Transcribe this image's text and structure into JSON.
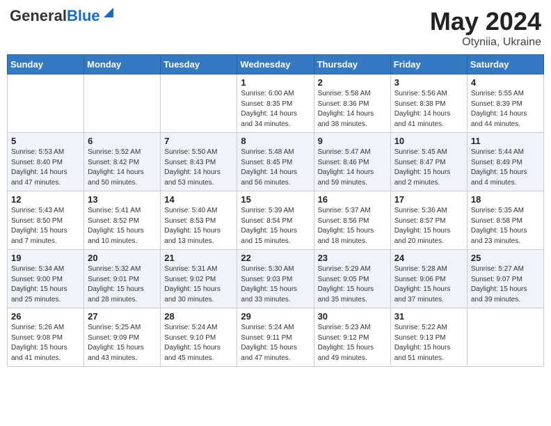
{
  "header": {
    "logo_general": "General",
    "logo_blue": "Blue",
    "title": "May 2024",
    "location": "Otyniia, Ukraine"
  },
  "days_of_week": [
    "Sunday",
    "Monday",
    "Tuesday",
    "Wednesday",
    "Thursday",
    "Friday",
    "Saturday"
  ],
  "weeks": [
    [
      {
        "day": "",
        "info": ""
      },
      {
        "day": "",
        "info": ""
      },
      {
        "day": "",
        "info": ""
      },
      {
        "day": "1",
        "info": "Sunrise: 6:00 AM\nSunset: 8:35 PM\nDaylight: 14 hours\nand 34 minutes."
      },
      {
        "day": "2",
        "info": "Sunrise: 5:58 AM\nSunset: 8:36 PM\nDaylight: 14 hours\nand 38 minutes."
      },
      {
        "day": "3",
        "info": "Sunrise: 5:56 AM\nSunset: 8:38 PM\nDaylight: 14 hours\nand 41 minutes."
      },
      {
        "day": "4",
        "info": "Sunrise: 5:55 AM\nSunset: 8:39 PM\nDaylight: 14 hours\nand 44 minutes."
      }
    ],
    [
      {
        "day": "5",
        "info": "Sunrise: 5:53 AM\nSunset: 8:40 PM\nDaylight: 14 hours\nand 47 minutes."
      },
      {
        "day": "6",
        "info": "Sunrise: 5:52 AM\nSunset: 8:42 PM\nDaylight: 14 hours\nand 50 minutes."
      },
      {
        "day": "7",
        "info": "Sunrise: 5:50 AM\nSunset: 8:43 PM\nDaylight: 14 hours\nand 53 minutes."
      },
      {
        "day": "8",
        "info": "Sunrise: 5:48 AM\nSunset: 8:45 PM\nDaylight: 14 hours\nand 56 minutes."
      },
      {
        "day": "9",
        "info": "Sunrise: 5:47 AM\nSunset: 8:46 PM\nDaylight: 14 hours\nand 59 minutes."
      },
      {
        "day": "10",
        "info": "Sunrise: 5:45 AM\nSunset: 8:47 PM\nDaylight: 15 hours\nand 2 minutes."
      },
      {
        "day": "11",
        "info": "Sunrise: 5:44 AM\nSunset: 8:49 PM\nDaylight: 15 hours\nand 4 minutes."
      }
    ],
    [
      {
        "day": "12",
        "info": "Sunrise: 5:43 AM\nSunset: 8:50 PM\nDaylight: 15 hours\nand 7 minutes."
      },
      {
        "day": "13",
        "info": "Sunrise: 5:41 AM\nSunset: 8:52 PM\nDaylight: 15 hours\nand 10 minutes."
      },
      {
        "day": "14",
        "info": "Sunrise: 5:40 AM\nSunset: 8:53 PM\nDaylight: 15 hours\nand 13 minutes."
      },
      {
        "day": "15",
        "info": "Sunrise: 5:39 AM\nSunset: 8:54 PM\nDaylight: 15 hours\nand 15 minutes."
      },
      {
        "day": "16",
        "info": "Sunrise: 5:37 AM\nSunset: 8:56 PM\nDaylight: 15 hours\nand 18 minutes."
      },
      {
        "day": "17",
        "info": "Sunrise: 5:36 AM\nSunset: 8:57 PM\nDaylight: 15 hours\nand 20 minutes."
      },
      {
        "day": "18",
        "info": "Sunrise: 5:35 AM\nSunset: 8:58 PM\nDaylight: 15 hours\nand 23 minutes."
      }
    ],
    [
      {
        "day": "19",
        "info": "Sunrise: 5:34 AM\nSunset: 9:00 PM\nDaylight: 15 hours\nand 25 minutes."
      },
      {
        "day": "20",
        "info": "Sunrise: 5:32 AM\nSunset: 9:01 PM\nDaylight: 15 hours\nand 28 minutes."
      },
      {
        "day": "21",
        "info": "Sunrise: 5:31 AM\nSunset: 9:02 PM\nDaylight: 15 hours\nand 30 minutes."
      },
      {
        "day": "22",
        "info": "Sunrise: 5:30 AM\nSunset: 9:03 PM\nDaylight: 15 hours\nand 33 minutes."
      },
      {
        "day": "23",
        "info": "Sunrise: 5:29 AM\nSunset: 9:05 PM\nDaylight: 15 hours\nand 35 minutes."
      },
      {
        "day": "24",
        "info": "Sunrise: 5:28 AM\nSunset: 9:06 PM\nDaylight: 15 hours\nand 37 minutes."
      },
      {
        "day": "25",
        "info": "Sunrise: 5:27 AM\nSunset: 9:07 PM\nDaylight: 15 hours\nand 39 minutes."
      }
    ],
    [
      {
        "day": "26",
        "info": "Sunrise: 5:26 AM\nSunset: 9:08 PM\nDaylight: 15 hours\nand 41 minutes."
      },
      {
        "day": "27",
        "info": "Sunrise: 5:25 AM\nSunset: 9:09 PM\nDaylight: 15 hours\nand 43 minutes."
      },
      {
        "day": "28",
        "info": "Sunrise: 5:24 AM\nSunset: 9:10 PM\nDaylight: 15 hours\nand 45 minutes."
      },
      {
        "day": "29",
        "info": "Sunrise: 5:24 AM\nSunset: 9:11 PM\nDaylight: 15 hours\nand 47 minutes."
      },
      {
        "day": "30",
        "info": "Sunrise: 5:23 AM\nSunset: 9:12 PM\nDaylight: 15 hours\nand 49 minutes."
      },
      {
        "day": "31",
        "info": "Sunrise: 5:22 AM\nSunset: 9:13 PM\nDaylight: 15 hours\nand 51 minutes."
      },
      {
        "day": "",
        "info": ""
      }
    ]
  ]
}
